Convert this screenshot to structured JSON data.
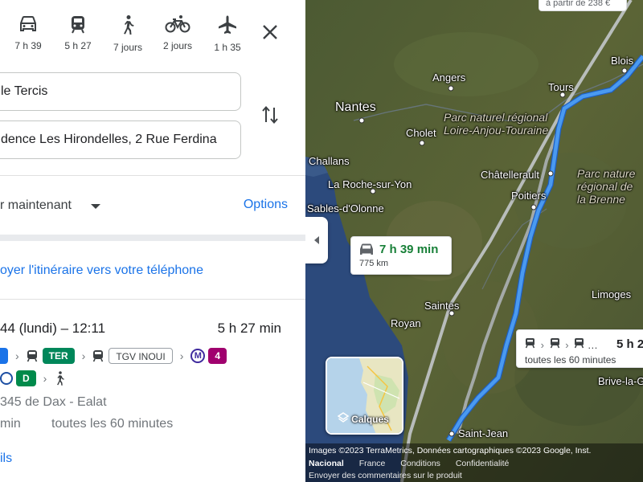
{
  "travel_modes": [
    {
      "name": "car",
      "time": "7 h 39"
    },
    {
      "name": "transit",
      "time": "5 h 27"
    },
    {
      "name": "walk",
      "time": "7 jours"
    },
    {
      "name": "bike",
      "time": "2 jours"
    },
    {
      "name": "plane",
      "time": "1 h 35"
    }
  ],
  "origin": "le Tercis",
  "destination": "dence Les Hirondelles, 2 Rue Ferdina",
  "depart": "r maintenant",
  "options_label": "Options",
  "send_to_phone": "oyer l'itinéraire vers votre téléphone",
  "route": {
    "date_time": "44 (lundi) – 12:11",
    "duration": "5 h 27 min",
    "lines": {
      "ter": "TER",
      "tgv": "TGV INOUI",
      "metro": "4",
      "rer": "D"
    },
    "from_station": "345 de Dax - Ealat",
    "wait": "min",
    "frequency": "toutes les 60 minutes",
    "details": "ils"
  },
  "map": {
    "labels": {
      "angers": "Angers",
      "tours": "Tours",
      "blois": "Blois",
      "nantes": "Nantes",
      "park1_line1": "Parc naturel régional",
      "park1_line2": "Loire-Anjou-Touraine",
      "cholet": "Cholet",
      "challans": "Challans",
      "chatellerault": "Châtellerault",
      "park2_line1": "Parc nature",
      "park2_line2": "régional de",
      "park2_line3": "la Brenne",
      "la_roche": "La Roche-sur-Yon",
      "poitiers": "Poitiers",
      "sables": "Sables-d'Olonne",
      "limoges": "Limoges",
      "saintes": "Saintes",
      "royan": "Royan",
      "brive": "Brive-la-G",
      "saint_jean": "Saint-Jean"
    },
    "car_callout": {
      "time": "7 h 39 min",
      "distance": "775 km"
    },
    "transit_callout": {
      "time": "5 h 2",
      "frequency": "toutes les 60 minutes"
    },
    "price_callout": "à partir de 238 €",
    "layers_label": "Calques",
    "attribution": {
      "line1": "Images ©2023 TerraMetrics, Données cartographiques ©2023 Google, Inst.",
      "nacional": "Nacional",
      "france": "France",
      "conditions": "Conditions",
      "confidentialite": "Confidentialité",
      "feedback": "Envoyer des commentaires sur le produit"
    }
  },
  "colors": {
    "accent": "#1a73e8",
    "route": "#4a9af0",
    "car_time": "#188038",
    "ter": "#00875a",
    "metro4": "#a0006e",
    "rer_d": "#008a4b"
  }
}
